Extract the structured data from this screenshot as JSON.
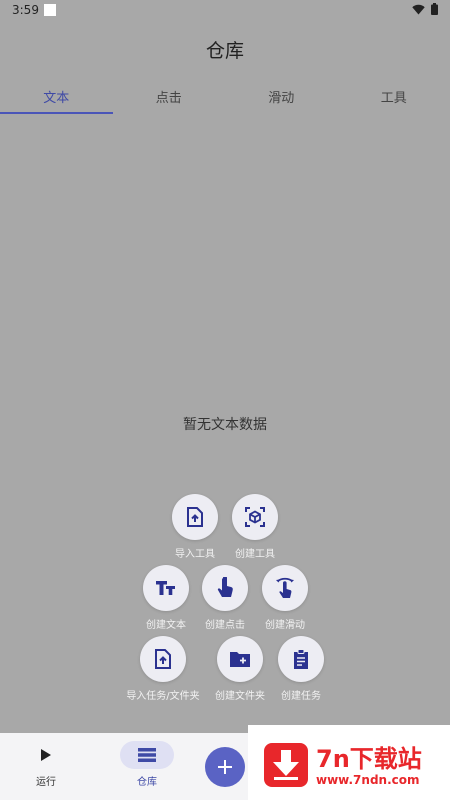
{
  "status_bar": {
    "time": "3:59"
  },
  "header": {
    "title": "仓库"
  },
  "tabs": [
    {
      "label": "文本",
      "active": true
    },
    {
      "label": "点击",
      "active": false
    },
    {
      "label": "滑动",
      "active": false
    },
    {
      "label": "工具",
      "active": false
    }
  ],
  "empty_state": "暂无文本数据",
  "fab_menu": {
    "import_tool": "导入工具",
    "create_tool": "创建工具",
    "create_text": "创建文本",
    "create_click": "创建点击",
    "create_swipe": "创建滑动",
    "import_task_folder": "导入任务/文件夹",
    "create_folder": "创建文件夹",
    "create_task": "创建任务"
  },
  "bottom_nav": {
    "run": "运行",
    "warehouse": "仓库"
  },
  "ad": {
    "title": "7n下载站",
    "url": "www.7ndn.com"
  },
  "colors": {
    "accent": "#3f4aa6",
    "fab": "#5a63c4",
    "ad_red": "#e8272b"
  }
}
